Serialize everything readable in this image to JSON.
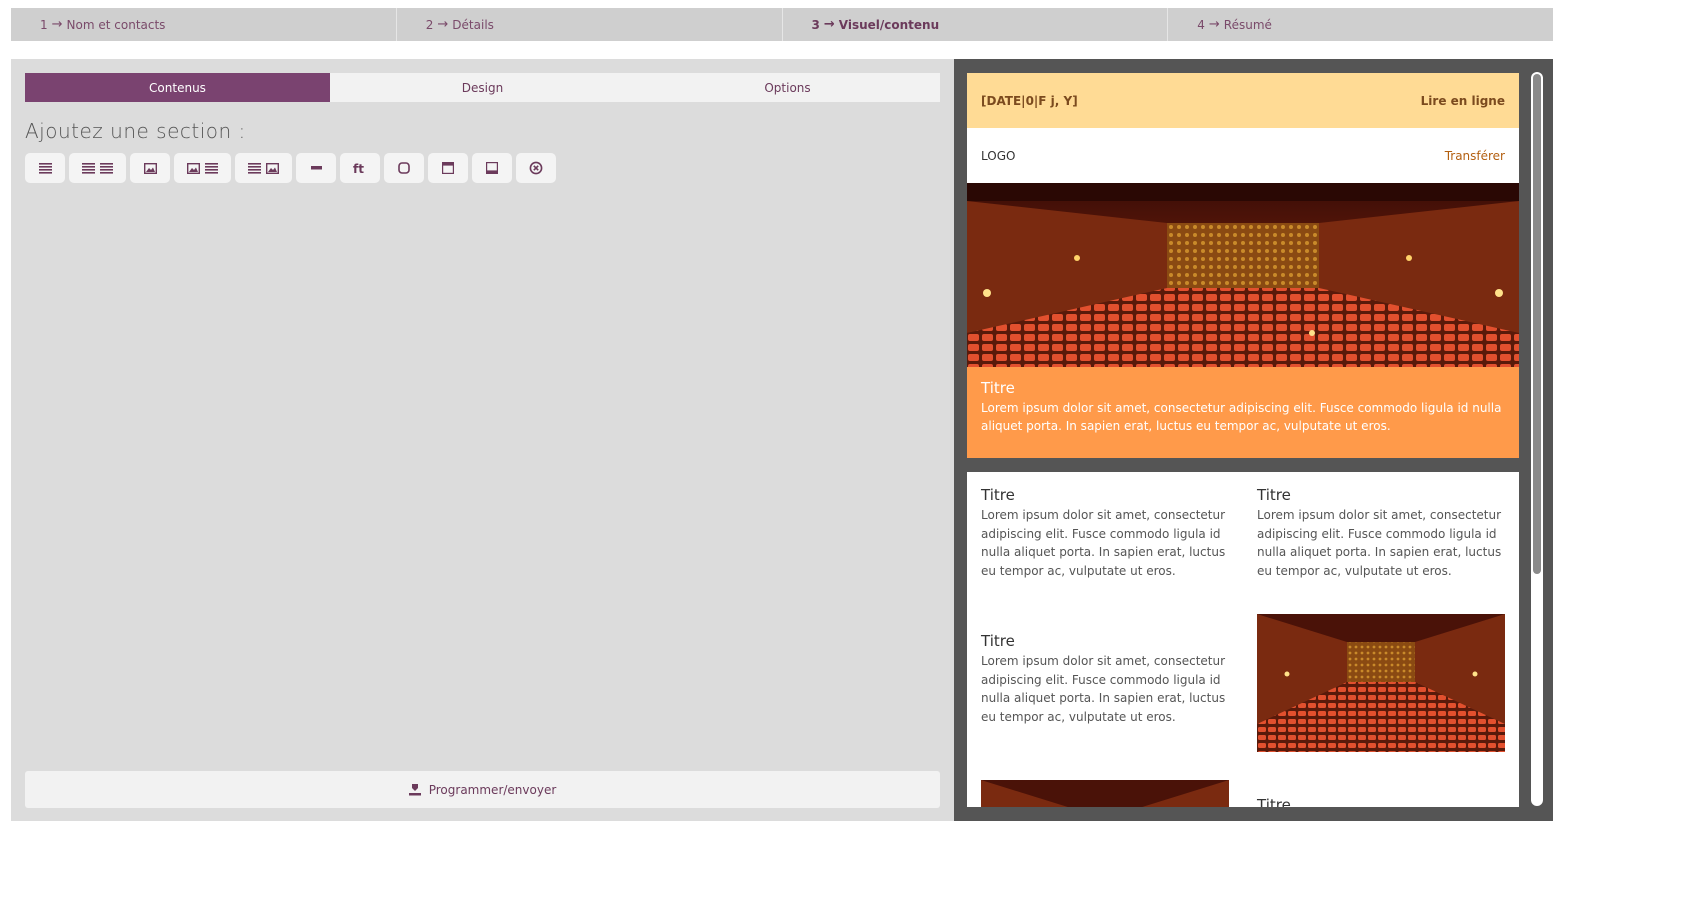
{
  "stepper": {
    "steps": [
      {
        "num": "1",
        "label": "Nom et contacts"
      },
      {
        "num": "2",
        "label": "Détails"
      },
      {
        "num": "3",
        "label": "Visuel/contenu"
      },
      {
        "num": "4",
        "label": "Résumé"
      }
    ],
    "active_index": 2
  },
  "editor": {
    "tabs": [
      "Contenus",
      "Design",
      "Options"
    ],
    "active_tab": "Contenus",
    "add_section_title": "Ajoutez une section :",
    "section_buttons": [
      "text",
      "two-columns-text",
      "image",
      "image-text",
      "text-image",
      "divider",
      "social",
      "button",
      "header",
      "footer",
      "delete"
    ],
    "send_label": "Programmer/envoyer"
  },
  "preview": {
    "date_tag": "[DATE|0|F j, Y]",
    "online_link": "Lire en ligne",
    "logo": "LOGO",
    "forward_link": "Transférer",
    "hero": {
      "title": "Titre",
      "text": "Lorem ipsum dolor sit amet, consectetur adipiscing elit. Fusce commodo ligula id nulla aliquet porta. In sapien erat, luctus eu tempor ac, vulputate ut eros."
    },
    "blocks": [
      {
        "title": "Titre",
        "text": "Lorem ipsum dolor sit amet, consectetur adipiscing elit. Fusce commodo ligula id nulla aliquet porta. In sapien erat, luctus eu tempor ac, vulputate ut eros."
      },
      {
        "title": "Titre",
        "text": "Lorem ipsum dolor sit amet, consectetur adipiscing elit. Fusce commodo ligula id nulla aliquet porta. In sapien erat, luctus eu tempor ac, vulputate ut eros."
      },
      {
        "title": "Titre",
        "text": "Lorem ipsum dolor sit amet, consectetur adipiscing elit. Fusce commodo ligula id nulla aliquet porta. In sapien erat, luctus eu tempor ac, vulputate ut eros."
      },
      {
        "title": "Titre"
      }
    ]
  },
  "colors": {
    "accent": "#7a4370",
    "header_band": "#ffdb95",
    "highlight_band": "#ff9a4a"
  }
}
